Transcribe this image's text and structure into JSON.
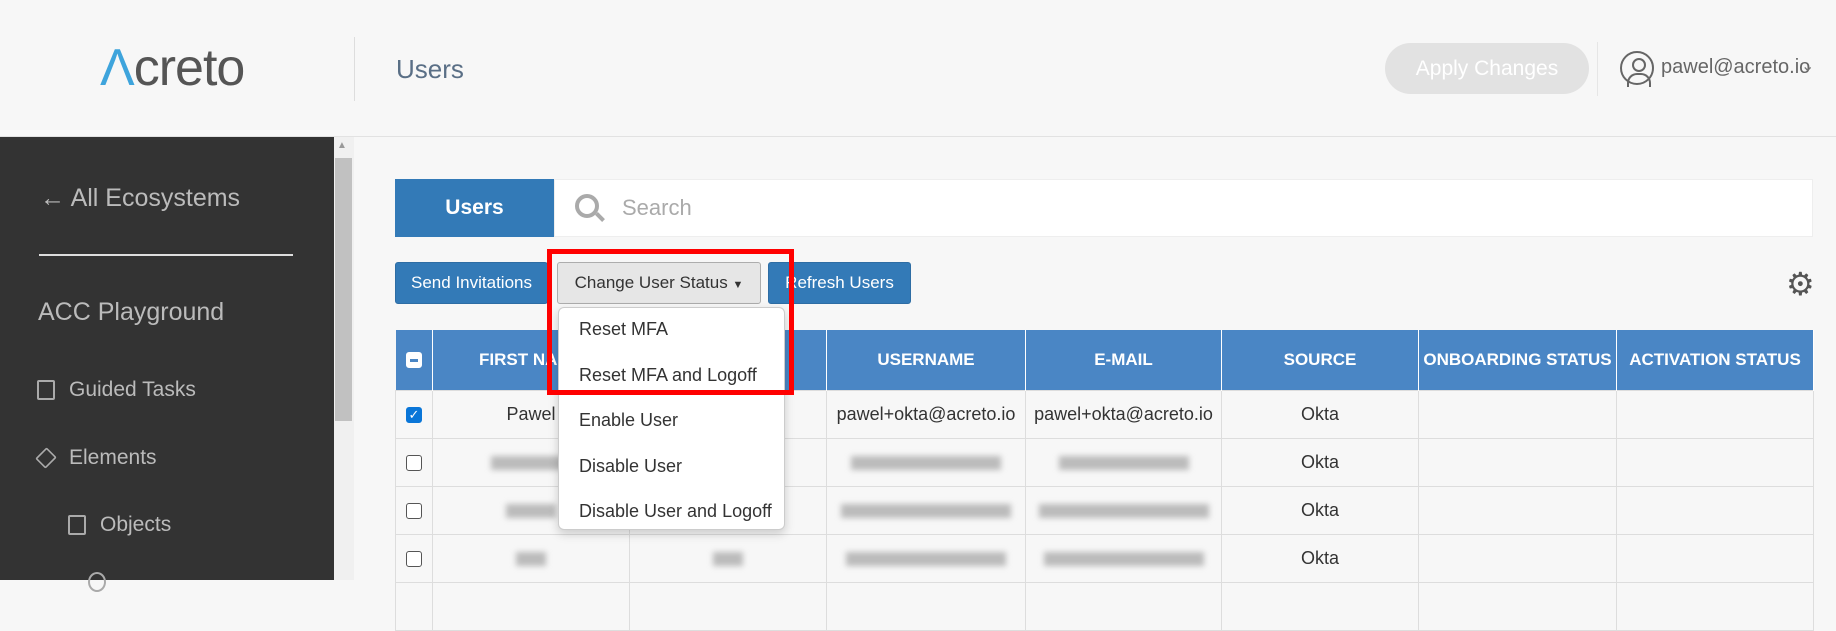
{
  "header": {
    "logo": "Acreto",
    "title": "Users",
    "apply_label": "Apply Changes",
    "user_email": "pawel@acreto.io"
  },
  "sidebar": {
    "back_label": "All Ecosystems",
    "ecosystem": "ACC Playground",
    "items": [
      {
        "label": "Guided Tasks",
        "icon": "document-icon"
      },
      {
        "label": "Elements",
        "icon": "layers-icon"
      },
      {
        "label": "Objects",
        "icon": "add-box-icon"
      }
    ]
  },
  "main": {
    "tab_label": "Users",
    "search_placeholder": "Search",
    "toolbar": {
      "send_label": "Send Invitations",
      "change_label": "Change User Status",
      "refresh_label": "Refresh Users"
    },
    "dropdown": [
      "Reset MFA",
      "Reset MFA and Logoff",
      "Enable User",
      "Disable User",
      "Disable User and Logoff"
    ],
    "table": {
      "headers": [
        "FIRST NAME",
        "USERNAME",
        "E-MAIL",
        "SOURCE",
        "ONBOARDING STATUS",
        "ACTIVATION STATUS"
      ],
      "rows": [
        {
          "checked": true,
          "first": "Pawel",
          "username": "pawel+okta@acreto.io",
          "email": "pawel+okta@acreto.io",
          "source": "Okta"
        },
        {
          "checked": false,
          "source": "Okta"
        },
        {
          "checked": false,
          "source": "Okta"
        },
        {
          "checked": false,
          "source": "Okta"
        }
      ]
    }
  },
  "colors": {
    "primary": "#337ab7",
    "table_header": "#4a86c5",
    "sidebar": "#333333",
    "highlight": "#ff0000"
  }
}
